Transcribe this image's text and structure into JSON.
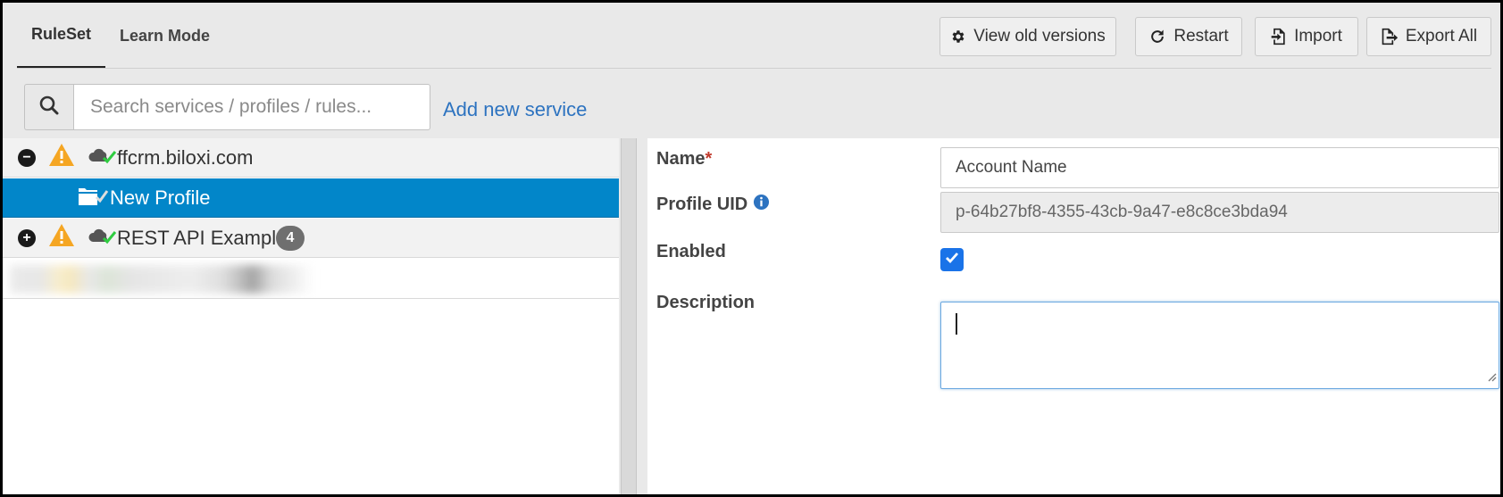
{
  "tabs": [
    {
      "label": "RuleSet",
      "active": true
    },
    {
      "label": "Learn Mode",
      "active": false
    }
  ],
  "toolbar": {
    "view_old_versions": "View old versions",
    "restart": "Restart",
    "import": "Import",
    "export_all": "Export All"
  },
  "search": {
    "placeholder": "Search services / profiles / rules...",
    "value": ""
  },
  "add_service_link": "Add new service",
  "tree": {
    "services": [
      {
        "name": "ffcrm.biloxi.com",
        "expanded": true,
        "toggle": "−",
        "warning": true,
        "profiles": [
          {
            "name": "New Profile",
            "selected": true
          }
        ]
      },
      {
        "name": "REST API Examples",
        "expanded": false,
        "toggle": "+",
        "warning": true,
        "count": "4"
      }
    ]
  },
  "form": {
    "name_label": "Name",
    "required_mark": "*",
    "name_value": "Account Name",
    "uid_label": "Profile UID",
    "uid_value": "p-64b27bf8-4355-43cb-9a47-e8c8ce3bda94",
    "enabled_label": "Enabled",
    "enabled": true,
    "description_label": "Description",
    "description_value": ""
  },
  "colors": {
    "selection": "#0286c9",
    "link": "#2d73c0",
    "warning": "#f5a623",
    "check_green": "#2ecc40",
    "checkbox": "#1a73e8",
    "required": "#c0392b"
  }
}
